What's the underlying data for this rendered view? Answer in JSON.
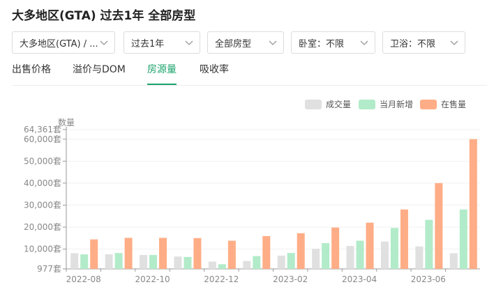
{
  "page": {
    "title": "大多地区(GTA) 过去1年 全部房型"
  },
  "filters": [
    {
      "label": "大多地区(GTA) / ..."
    },
    {
      "label": "过去1年"
    },
    {
      "label": "全部房型"
    },
    {
      "label": "卧室：不限"
    },
    {
      "label": "卫浴：不限"
    }
  ],
  "tabs": [
    {
      "label": "出售价格",
      "active": false
    },
    {
      "label": "溢价与DOM",
      "active": false
    },
    {
      "label": "房源量",
      "active": true
    },
    {
      "label": "吸收率",
      "active": false
    }
  ],
  "colors": {
    "accent": "#1aa36b",
    "sold": "#e0e0e0",
    "new_listings": "#b2ebc9",
    "active_listings": "#ffad86"
  },
  "chart_data": {
    "type": "bar",
    "ylabel": "数量",
    "ylim": [
      977,
      64361
    ],
    "y_ticks": [
      {
        "value": 977,
        "label": "977套"
      },
      {
        "value": 10000,
        "label": "10,000套"
      },
      {
        "value": 20000,
        "label": "20,000套"
      },
      {
        "value": 30000,
        "label": "30,000套"
      },
      {
        "value": 40000,
        "label": "40,000套"
      },
      {
        "value": 50000,
        "label": "50,000套"
      },
      {
        "value": 60000,
        "label": "60,000套"
      },
      {
        "value": 64361,
        "label": "64,361套"
      }
    ],
    "categories": [
      "2022-08",
      "2022-09",
      "2022-10",
      "2022-11",
      "2022-12",
      "2023-01",
      "2023-02",
      "2023-03",
      "2023-04",
      "2023-05",
      "2023-06",
      "2023-07"
    ],
    "x_tick_labels": [
      "2022-08",
      "2022-10",
      "2022-12",
      "2023-02",
      "2023-04",
      "2023-06"
    ],
    "legend_position": "top-right",
    "series": [
      {
        "name": "成交量",
        "color": "#e0e0e0",
        "values": [
          8100,
          7600,
          7300,
          6600,
          4300,
          4600,
          7000,
          10100,
          11400,
          13400,
          11200,
          8100
        ]
      },
      {
        "name": "当月新增",
        "color": "#b2ebc9",
        "values": [
          7600,
          8200,
          7300,
          6400,
          3100,
          6800,
          8200,
          12700,
          13800,
          19600,
          23300,
          28000
        ]
      },
      {
        "name": "在售量",
        "color": "#ffad86",
        "values": [
          14400,
          15100,
          15100,
          15000,
          13800,
          15900,
          17200,
          19800,
          22000,
          28000,
          40000,
          60000
        ]
      }
    ]
  }
}
